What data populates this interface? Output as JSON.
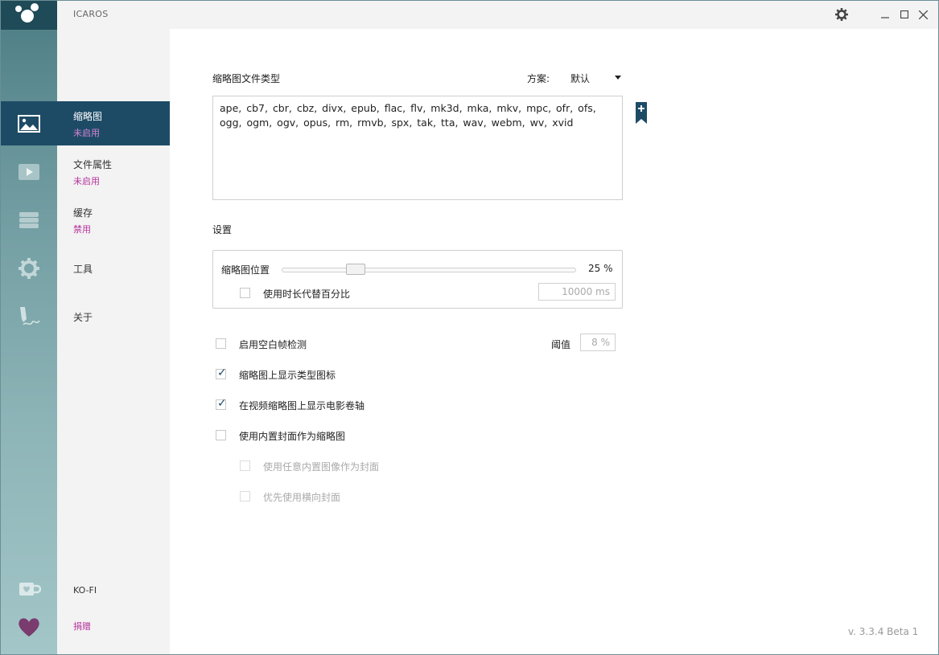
{
  "window": {
    "title": "ICAROS"
  },
  "nav": {
    "items": [
      {
        "label": "缩略图",
        "status": "未启用",
        "icon": "image-icon"
      },
      {
        "label": "文件属性",
        "status": "未启用",
        "icon": "video-icon"
      },
      {
        "label": "缓存",
        "status": "禁用",
        "icon": "database-icon"
      },
      {
        "label": "工具",
        "status": "",
        "icon": "gear-icon"
      },
      {
        "label": "关于",
        "status": "",
        "icon": "signature-icon"
      }
    ],
    "kofi": {
      "label": "KO-FI",
      "icon": "coffee-cup-icon"
    },
    "donate": {
      "label": "捐赠",
      "icon": "heart-icon"
    }
  },
  "main": {
    "filetypes_heading": "缩略图文件类型",
    "preset_label": "方案:",
    "preset_value": "默认",
    "filetypes_text": "ape,  cb7,  cbr,  cbz,  divx,  epub,  flac,  flv,  mk3d,  mka,  mkv,  mpc,  ofr,  ofs,  ogg,  ogm,  ogv,  opus,  rm,  rmvb,  spx,  tak,  tta,  wav,  webm,  wv,  xvid",
    "settings_heading": "设置",
    "thumb_position_label": "缩略图位置",
    "thumb_position_value": "25 %",
    "thumb_position_fraction": 0.25,
    "use_duration_label": "使用时长代替百分比",
    "use_duration_checked": false,
    "duration_value": "10000 ms",
    "blank_frame_label": "启用空白帧检测",
    "blank_frame_checked": false,
    "threshold_label": "阈值",
    "threshold_value": "8 %",
    "show_type_icon_label": "缩略图上显示类型图标",
    "show_type_icon_checked": true,
    "show_filmstrip_label": "在视频缩略图上显示电影卷轴",
    "show_filmstrip_checked": true,
    "use_cover_label": "使用内置封面作为缩略图",
    "use_cover_checked": false,
    "any_image_cover_label": "使用任意内置图像作为封面",
    "prefer_landscape_label": "优先使用横向封面"
  },
  "version": "v. 3.3.4 Beta 1",
  "colors": {
    "accent": "#1d4b66",
    "status": "#b5339d",
    "heart": "#7a3b6e"
  }
}
